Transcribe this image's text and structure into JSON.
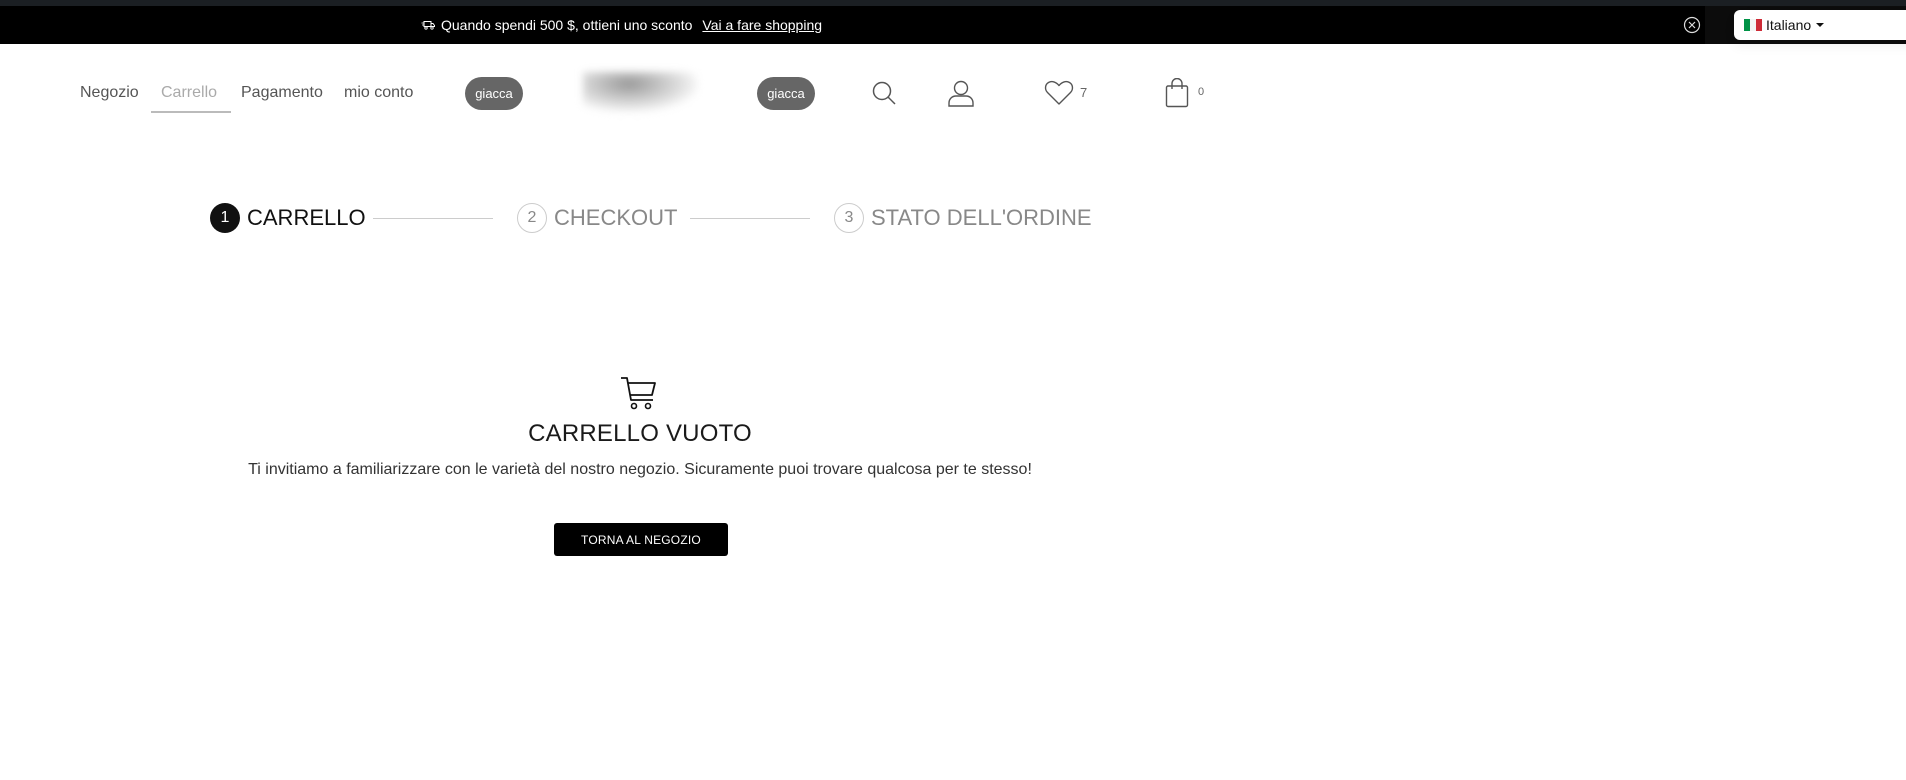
{
  "promo": {
    "icon": "truck-icon",
    "message": "Quando spendi 500 $, ottieni uno sconto",
    "link_label": "Vai a fare shopping",
    "close_icon": "close-circle-icon"
  },
  "language": {
    "selected": "Italiano",
    "flag_colors": [
      "#009246",
      "#ffffff",
      "#ce2b37"
    ]
  },
  "nav": {
    "links": [
      {
        "label": "Negozio"
      },
      {
        "label": "Carrello",
        "active": true
      },
      {
        "label": "Pagamento"
      },
      {
        "label": "mio conto"
      }
    ],
    "pill_left": "giacca",
    "pill_right": "giacca",
    "wishlist_count": "7",
    "bag_count": "0"
  },
  "stepper": {
    "steps": [
      {
        "number": "1",
        "label": "CARRELLO",
        "active": true
      },
      {
        "number": "2",
        "label": "CHECKOUT",
        "active": false
      },
      {
        "number": "3",
        "label": "STATO DELL'ORDINE",
        "active": false
      }
    ]
  },
  "empty_cart": {
    "icon": "shopping-cart-icon",
    "title": "CARRELLO VUOTO",
    "message": "Ti invitiamo a familiarizzare con le varietà del nostro negozio. Sicuramente puoi trovare qualcosa per te stesso!",
    "button_label": "TORNA AL NEGOZIO"
  },
  "colors": {
    "promo_bg": "#000000",
    "active_step": "#111111",
    "pill_bg": "#666666",
    "button_bg": "#000000"
  }
}
